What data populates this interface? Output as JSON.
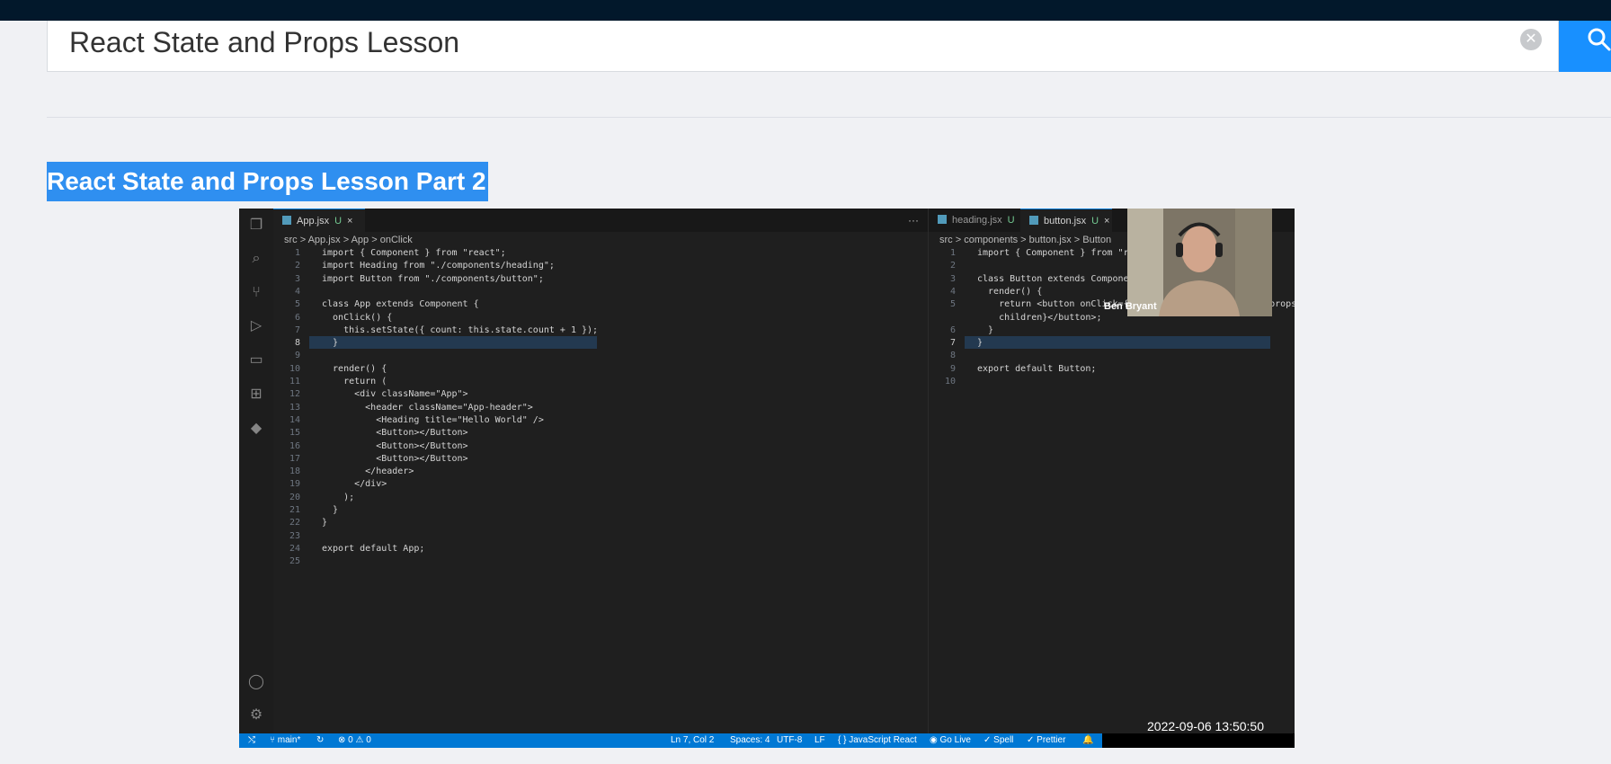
{
  "search": {
    "query": "React State and Props Lesson",
    "clear_icon": "close-circle-icon",
    "search_icon": "search-icon"
  },
  "lesson": {
    "title": "React State and Props Lesson Part 2"
  },
  "video": {
    "presenter_name": "Ben Bryant",
    "timestamp": "2022-09-06 13:50:50",
    "editor": {
      "left_tab": {
        "label": "App.jsx",
        "badge": "U"
      },
      "right_tabs": [
        {
          "label": "heading.jsx",
          "badge": "U"
        },
        {
          "label": "button.jsx",
          "badge": "U"
        }
      ],
      "left_breadcrumb": "src > App.jsx > App > onClick",
      "right_breadcrumb": "src > components > button.jsx > Button",
      "left_code": [
        "import { Component } from \"react\";",
        "import Heading from \"./components/heading\";",
        "import Button from \"./components/button\";",
        "",
        "class App extends Component {",
        "  onClick() {",
        "    this.setState({ count: this.state.count + 1 });",
        "  }",
        "",
        "  render() {",
        "    return (",
        "      <div className=\"App\">",
        "        <header className=\"App-header\">",
        "          <Heading title=\"Hello World\" />",
        "          <Button></Button>",
        "          <Button></Button>",
        "          <Button></Button>",
        "        </header>",
        "      </div>",
        "    );",
        "  }",
        "}",
        "",
        "export default App;",
        ""
      ],
      "right_code": [
        {
          "n": "1",
          "t": "import { Component } from \"react\";"
        },
        {
          "n": "2",
          "t": ""
        },
        {
          "n": "3",
          "t": "class Button extends Component {"
        },
        {
          "n": "4",
          "t": "  render() {"
        },
        {
          "n": "5",
          "t": "    return <button onClick={this.props.onClick}>{this.props."
        },
        {
          "n": "",
          "t": "    children}</button>;"
        },
        {
          "n": "6",
          "t": "  }"
        },
        {
          "n": "7",
          "t": "}"
        },
        {
          "n": "8",
          "t": ""
        },
        {
          "n": "9",
          "t": "export default Button;"
        },
        {
          "n": "10",
          "t": ""
        }
      ],
      "status": {
        "branch": "main*",
        "errors": "0",
        "warnings": "0",
        "position": "Ln 7, Col 2",
        "spaces": "Spaces: 4",
        "encoding": "UTF-8",
        "eol": "LF",
        "language": "JavaScript React",
        "go_live": "Go Live",
        "spell": "Spell",
        "prettier": "Prettier"
      }
    }
  }
}
